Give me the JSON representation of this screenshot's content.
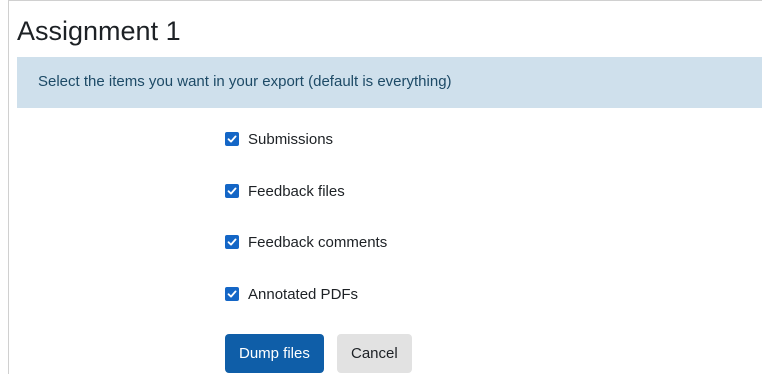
{
  "page": {
    "title": "Assignment 1"
  },
  "info_bar": {
    "text": "Select the items you want in your export (default is everything)"
  },
  "options": [
    {
      "label": "Submissions",
      "checked": true
    },
    {
      "label": "Feedback files",
      "checked": true
    },
    {
      "label": "Feedback comments",
      "checked": true
    },
    {
      "label": "Annotated PDFs",
      "checked": true
    }
  ],
  "buttons": {
    "primary_label": "Dump files",
    "cancel_label": "Cancel"
  },
  "colors": {
    "info_bar_bg": "#cfe0ec",
    "checkbox_accent": "#1466c6",
    "primary_button": "#0f5ea8",
    "secondary_button": "#e2e2e2"
  }
}
